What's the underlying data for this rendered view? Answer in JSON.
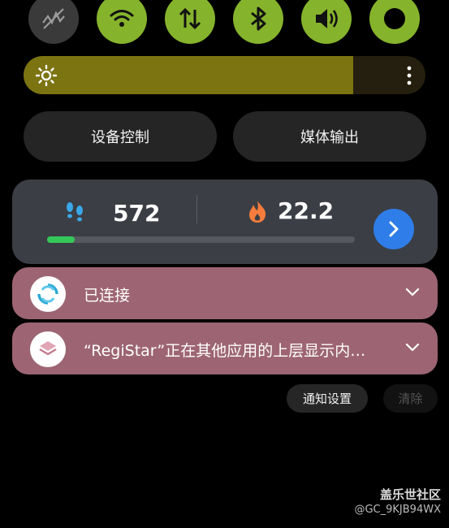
{
  "quick_toggles": [
    {
      "name": "mobile-data-off",
      "state": "off"
    },
    {
      "name": "wifi",
      "state": "on"
    },
    {
      "name": "data-transfer",
      "state": "on"
    },
    {
      "name": "bluetooth",
      "state": "on"
    },
    {
      "name": "sound",
      "state": "on"
    },
    {
      "name": "ring",
      "state": "on"
    }
  ],
  "brightness": {
    "level_percent": 82,
    "icon": "sun-icon"
  },
  "buttons": {
    "device_control": "设备控制",
    "media_output": "媒体输出"
  },
  "health": {
    "steps": "572",
    "calories": "22.2",
    "progress_percent": 9
  },
  "notifications": [
    {
      "text": "已连接",
      "icon": "connect-icon"
    },
    {
      "text": "“RegiStar”正在其他应用的上层显示内…",
      "icon": "layers-icon"
    }
  ],
  "actions": {
    "settings": "通知设置",
    "clear": "清除"
  },
  "watermark": {
    "brand": "盖乐世社区",
    "handle": "@GC_9KJB94WX"
  },
  "colors": {
    "toggle_on": "#86b32c",
    "brightness_fill": "#7c7411",
    "notification_bg": "#9d6573",
    "health_card": "#3b3e44",
    "steps_progress": "#34c759",
    "go_button": "#2f7de8"
  }
}
